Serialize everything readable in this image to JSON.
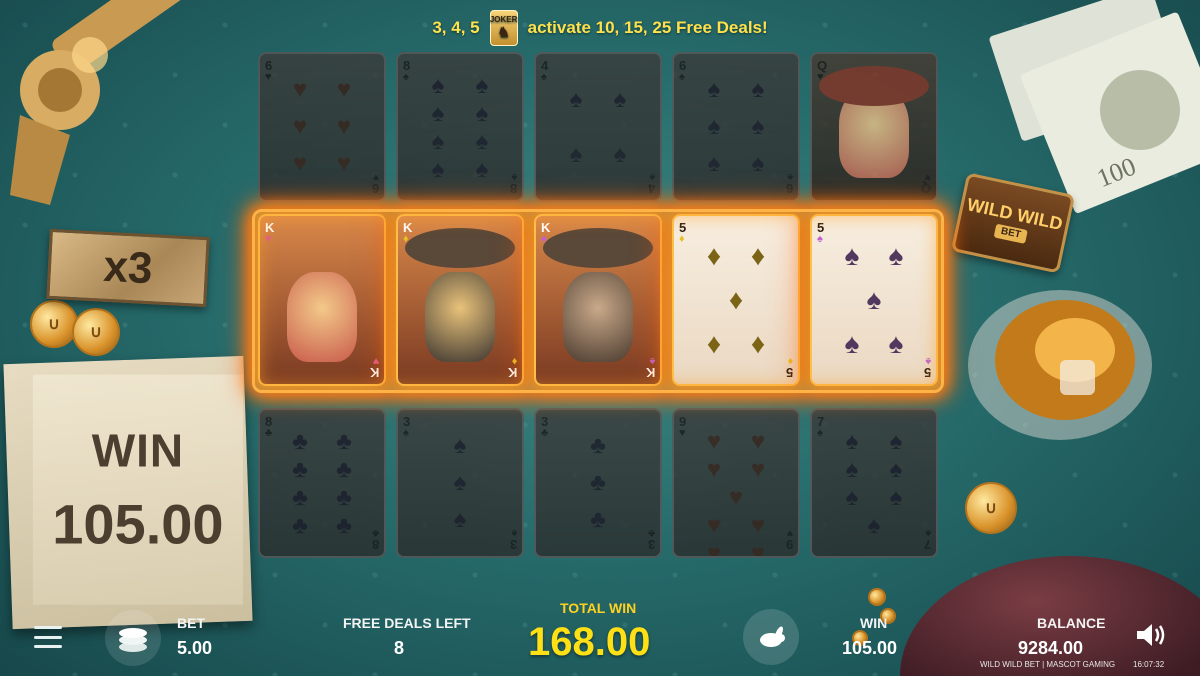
{
  "banner": {
    "counts": "3, 4, 5",
    "scatter_label": "JOKER",
    "text": "activate 10, 15, 25 Free Deals!"
  },
  "multiplier": "x3",
  "logo": {
    "line1": "WILD WILD",
    "line2": "BET"
  },
  "win_panel": {
    "label": "WIN",
    "amount": "105.00"
  },
  "grid": {
    "rows": [
      [
        {
          "rank": "6",
          "suit": "heart",
          "pips": 6,
          "face": false
        },
        {
          "rank": "8",
          "suit": "spade",
          "pips": 8,
          "face": false
        },
        {
          "rank": "4",
          "suit": "spade",
          "pips": 4,
          "face": false
        },
        {
          "rank": "6",
          "suit": "spade",
          "pips": 6,
          "face": false
        },
        {
          "rank": "Q",
          "suit": "heart",
          "pips": 0,
          "face": true
        }
      ],
      [
        {
          "rank": "K",
          "suit": "heart",
          "pips": 0,
          "face": true
        },
        {
          "rank": "K",
          "suit": "diamond",
          "pips": 0,
          "face": true
        },
        {
          "rank": "K",
          "suit": "spade",
          "pips": 0,
          "face": true
        },
        {
          "rank": "5",
          "suit": "diamond",
          "pips": 5,
          "face": false
        },
        {
          "rank": "5",
          "suit": "spade",
          "pips": 5,
          "face": false
        }
      ],
      [
        {
          "rank": "8",
          "suit": "club",
          "pips": 8,
          "face": false
        },
        {
          "rank": "3",
          "suit": "spade",
          "pips": 3,
          "face": false
        },
        {
          "rank": "3",
          "suit": "club",
          "pips": 3,
          "face": false
        },
        {
          "rank": "9",
          "suit": "heart",
          "pips": 9,
          "face": false
        },
        {
          "rank": "7",
          "suit": "spade",
          "pips": 7,
          "face": false
        }
      ]
    ],
    "winning_row": 1
  },
  "bottom": {
    "bet_label": "BET",
    "bet_value": "5.00",
    "free_deals_label": "FREE DEALS LEFT",
    "free_deals_value": "8",
    "total_win_label": "TOTAL WIN",
    "total_win_value": "168.00",
    "win_label": "WIN",
    "win_value": "105.00",
    "balance_label": "BALANCE",
    "balance_value": "9284.00",
    "footer": "WILD WILD BET | MASCOT GAMING",
    "clock": "16:07:32"
  },
  "colors": {
    "table": "#276c6c",
    "highlight_glow": "#ffb347",
    "total_win": "#ffe014"
  }
}
